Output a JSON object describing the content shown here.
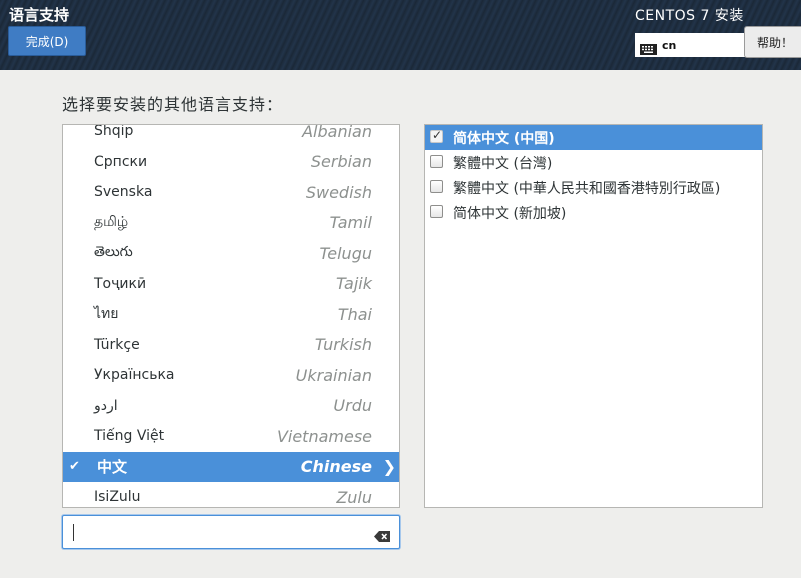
{
  "header": {
    "title": "语言支持",
    "done_label": "完成(D)",
    "product_title": "CENTOS 7 安装",
    "keyboard_layout": "cn",
    "help_label": "帮助！"
  },
  "main": {
    "prompt": "选择要安装的其他语言支持："
  },
  "languages": [
    {
      "native": "Shqip",
      "english": "Albanian"
    },
    {
      "native": "Српски",
      "english": "Serbian"
    },
    {
      "native": "Svenska",
      "english": "Swedish"
    },
    {
      "native": "தமிழ்",
      "english": "Tamil"
    },
    {
      "native": "తెలుగు",
      "english": "Telugu"
    },
    {
      "native": "Тоҷикӣ",
      "english": "Tajik"
    },
    {
      "native": "ไทย",
      "english": "Thai"
    },
    {
      "native": "Türkçe",
      "english": "Turkish"
    },
    {
      "native": "Українська",
      "english": "Ukrainian"
    },
    {
      "native": "اردو",
      "english": "Urdu"
    },
    {
      "native": "Tiếng Việt",
      "english": "Vietnamese"
    },
    {
      "native": "中文",
      "english": "Chinese",
      "selected": true
    },
    {
      "native": "IsiZulu",
      "english": "Zulu"
    }
  ],
  "search": {
    "value": "",
    "placeholder": ""
  },
  "locales": [
    {
      "label": "简体中文 (中国)",
      "checked": true,
      "selected": true
    },
    {
      "label": "繁體中文 (台灣)",
      "checked": false
    },
    {
      "label": "繁體中文 (中華人民共和國香港特別行政區)",
      "checked": false
    },
    {
      "label": "简体中文 (新加坡)",
      "checked": false
    }
  ],
  "colors": {
    "accent": "#4a90d9",
    "header_bg": "#1f2f42",
    "background": "#eeeeec"
  }
}
